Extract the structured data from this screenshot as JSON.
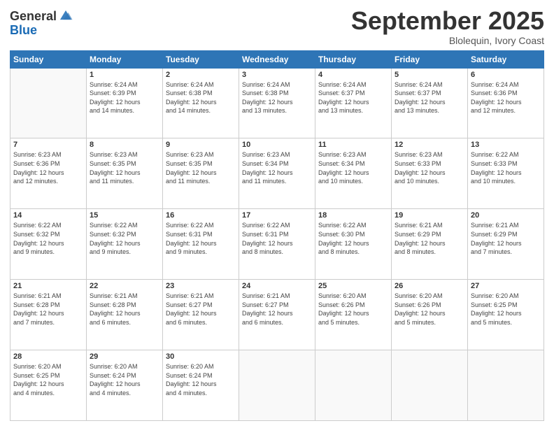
{
  "logo": {
    "line1": "General",
    "line2": "Blue"
  },
  "title": "September 2025",
  "subtitle": "Blolequin, Ivory Coast",
  "weekdays": [
    "Sunday",
    "Monday",
    "Tuesday",
    "Wednesday",
    "Thursday",
    "Friday",
    "Saturday"
  ],
  "weeks": [
    [
      {
        "day": "",
        "info": ""
      },
      {
        "day": "1",
        "info": "Sunrise: 6:24 AM\nSunset: 6:39 PM\nDaylight: 12 hours\nand 14 minutes."
      },
      {
        "day": "2",
        "info": "Sunrise: 6:24 AM\nSunset: 6:38 PM\nDaylight: 12 hours\nand 14 minutes."
      },
      {
        "day": "3",
        "info": "Sunrise: 6:24 AM\nSunset: 6:38 PM\nDaylight: 12 hours\nand 13 minutes."
      },
      {
        "day": "4",
        "info": "Sunrise: 6:24 AM\nSunset: 6:37 PM\nDaylight: 12 hours\nand 13 minutes."
      },
      {
        "day": "5",
        "info": "Sunrise: 6:24 AM\nSunset: 6:37 PM\nDaylight: 12 hours\nand 13 minutes."
      },
      {
        "day": "6",
        "info": "Sunrise: 6:24 AM\nSunset: 6:36 PM\nDaylight: 12 hours\nand 12 minutes."
      }
    ],
    [
      {
        "day": "7",
        "info": "Sunrise: 6:23 AM\nSunset: 6:36 PM\nDaylight: 12 hours\nand 12 minutes."
      },
      {
        "day": "8",
        "info": "Sunrise: 6:23 AM\nSunset: 6:35 PM\nDaylight: 12 hours\nand 11 minutes."
      },
      {
        "day": "9",
        "info": "Sunrise: 6:23 AM\nSunset: 6:35 PM\nDaylight: 12 hours\nand 11 minutes."
      },
      {
        "day": "10",
        "info": "Sunrise: 6:23 AM\nSunset: 6:34 PM\nDaylight: 12 hours\nand 11 minutes."
      },
      {
        "day": "11",
        "info": "Sunrise: 6:23 AM\nSunset: 6:34 PM\nDaylight: 12 hours\nand 10 minutes."
      },
      {
        "day": "12",
        "info": "Sunrise: 6:23 AM\nSunset: 6:33 PM\nDaylight: 12 hours\nand 10 minutes."
      },
      {
        "day": "13",
        "info": "Sunrise: 6:22 AM\nSunset: 6:33 PM\nDaylight: 12 hours\nand 10 minutes."
      }
    ],
    [
      {
        "day": "14",
        "info": "Sunrise: 6:22 AM\nSunset: 6:32 PM\nDaylight: 12 hours\nand 9 minutes."
      },
      {
        "day": "15",
        "info": "Sunrise: 6:22 AM\nSunset: 6:32 PM\nDaylight: 12 hours\nand 9 minutes."
      },
      {
        "day": "16",
        "info": "Sunrise: 6:22 AM\nSunset: 6:31 PM\nDaylight: 12 hours\nand 9 minutes."
      },
      {
        "day": "17",
        "info": "Sunrise: 6:22 AM\nSunset: 6:31 PM\nDaylight: 12 hours\nand 8 minutes."
      },
      {
        "day": "18",
        "info": "Sunrise: 6:22 AM\nSunset: 6:30 PM\nDaylight: 12 hours\nand 8 minutes."
      },
      {
        "day": "19",
        "info": "Sunrise: 6:21 AM\nSunset: 6:29 PM\nDaylight: 12 hours\nand 8 minutes."
      },
      {
        "day": "20",
        "info": "Sunrise: 6:21 AM\nSunset: 6:29 PM\nDaylight: 12 hours\nand 7 minutes."
      }
    ],
    [
      {
        "day": "21",
        "info": "Sunrise: 6:21 AM\nSunset: 6:28 PM\nDaylight: 12 hours\nand 7 minutes."
      },
      {
        "day": "22",
        "info": "Sunrise: 6:21 AM\nSunset: 6:28 PM\nDaylight: 12 hours\nand 6 minutes."
      },
      {
        "day": "23",
        "info": "Sunrise: 6:21 AM\nSunset: 6:27 PM\nDaylight: 12 hours\nand 6 minutes."
      },
      {
        "day": "24",
        "info": "Sunrise: 6:21 AM\nSunset: 6:27 PM\nDaylight: 12 hours\nand 6 minutes."
      },
      {
        "day": "25",
        "info": "Sunrise: 6:20 AM\nSunset: 6:26 PM\nDaylight: 12 hours\nand 5 minutes."
      },
      {
        "day": "26",
        "info": "Sunrise: 6:20 AM\nSunset: 6:26 PM\nDaylight: 12 hours\nand 5 minutes."
      },
      {
        "day": "27",
        "info": "Sunrise: 6:20 AM\nSunset: 6:25 PM\nDaylight: 12 hours\nand 5 minutes."
      }
    ],
    [
      {
        "day": "28",
        "info": "Sunrise: 6:20 AM\nSunset: 6:25 PM\nDaylight: 12 hours\nand 4 minutes."
      },
      {
        "day": "29",
        "info": "Sunrise: 6:20 AM\nSunset: 6:24 PM\nDaylight: 12 hours\nand 4 minutes."
      },
      {
        "day": "30",
        "info": "Sunrise: 6:20 AM\nSunset: 6:24 PM\nDaylight: 12 hours\nand 4 minutes."
      },
      {
        "day": "",
        "info": ""
      },
      {
        "day": "",
        "info": ""
      },
      {
        "day": "",
        "info": ""
      },
      {
        "day": "",
        "info": ""
      }
    ]
  ]
}
